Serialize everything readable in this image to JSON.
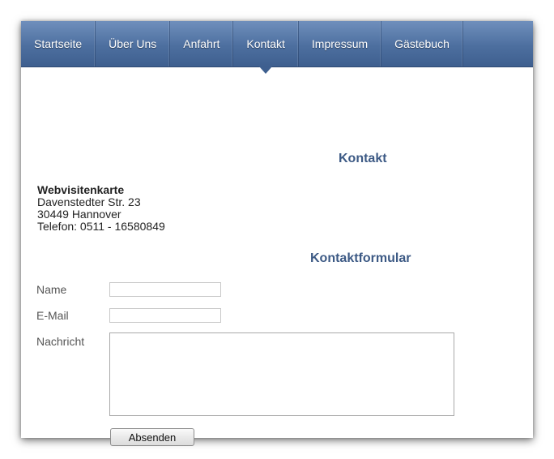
{
  "nav": {
    "items": [
      {
        "label": "Startseite"
      },
      {
        "label": "Über Uns"
      },
      {
        "label": "Anfahrt"
      },
      {
        "label": "Kontakt",
        "active": true
      },
      {
        "label": "Impressum"
      },
      {
        "label": "Gästebuch"
      }
    ]
  },
  "contact": {
    "heading": "Kontakt",
    "card": {
      "title": "Webvisitenkarte",
      "street": "Davenstedter Str. 23",
      "city": "30449 Hannover",
      "phone": "Telefon: 0511 - 16580849"
    }
  },
  "form": {
    "heading": "Kontaktformular",
    "name_label": "Name",
    "name_value": "",
    "email_label": "E-Mail",
    "email_value": "",
    "message_label": "Nachricht",
    "message_value": "",
    "submit_label": "Absenden"
  },
  "colors": {
    "nav_gradient_top": "#6f8fbc",
    "nav_gradient_bottom": "#3e5f8f",
    "heading_color": "#3d5a85"
  }
}
